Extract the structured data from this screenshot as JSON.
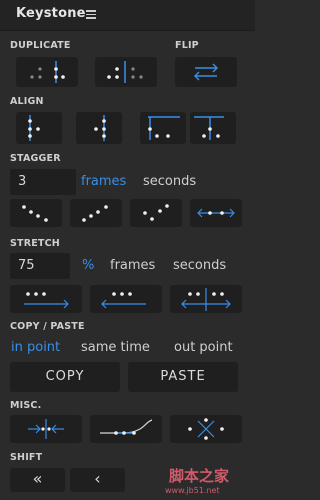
{
  "app": {
    "title": "Keystone",
    "menu_icon": "hamburger-icon"
  },
  "sections": {
    "duplicate": "DUPLICATE",
    "flip": "FLIP",
    "align": "ALIGN",
    "stagger": "STAGGER",
    "stretch": "STRETCH",
    "copy_paste": "COPY / PASTE",
    "misc": "MISC.",
    "shift": "SHIFT"
  },
  "stagger": {
    "value": "3",
    "units": [
      {
        "label": "frames",
        "active": true
      },
      {
        "label": "seconds",
        "active": false
      }
    ]
  },
  "stretch": {
    "value": "75",
    "units": [
      {
        "label": "%",
        "active": true
      },
      {
        "label": "frames",
        "active": false
      },
      {
        "label": "seconds",
        "active": false
      }
    ]
  },
  "copy_paste": {
    "modes": [
      {
        "label": "in point",
        "active": true
      },
      {
        "label": "same time",
        "active": false
      },
      {
        "label": "out point",
        "active": false
      }
    ],
    "copy_label": "COPY",
    "paste_label": "PASTE"
  },
  "shift": {
    "left_double": "«",
    "left_single": "‹"
  },
  "watermark": {
    "main": "脚本之家",
    "sub": "www.jb51.net"
  },
  "colors": {
    "accent": "#3a8ee6",
    "background": "#2b2b2b",
    "button": "#1f1f1f",
    "watermark": "#d35a6b"
  }
}
